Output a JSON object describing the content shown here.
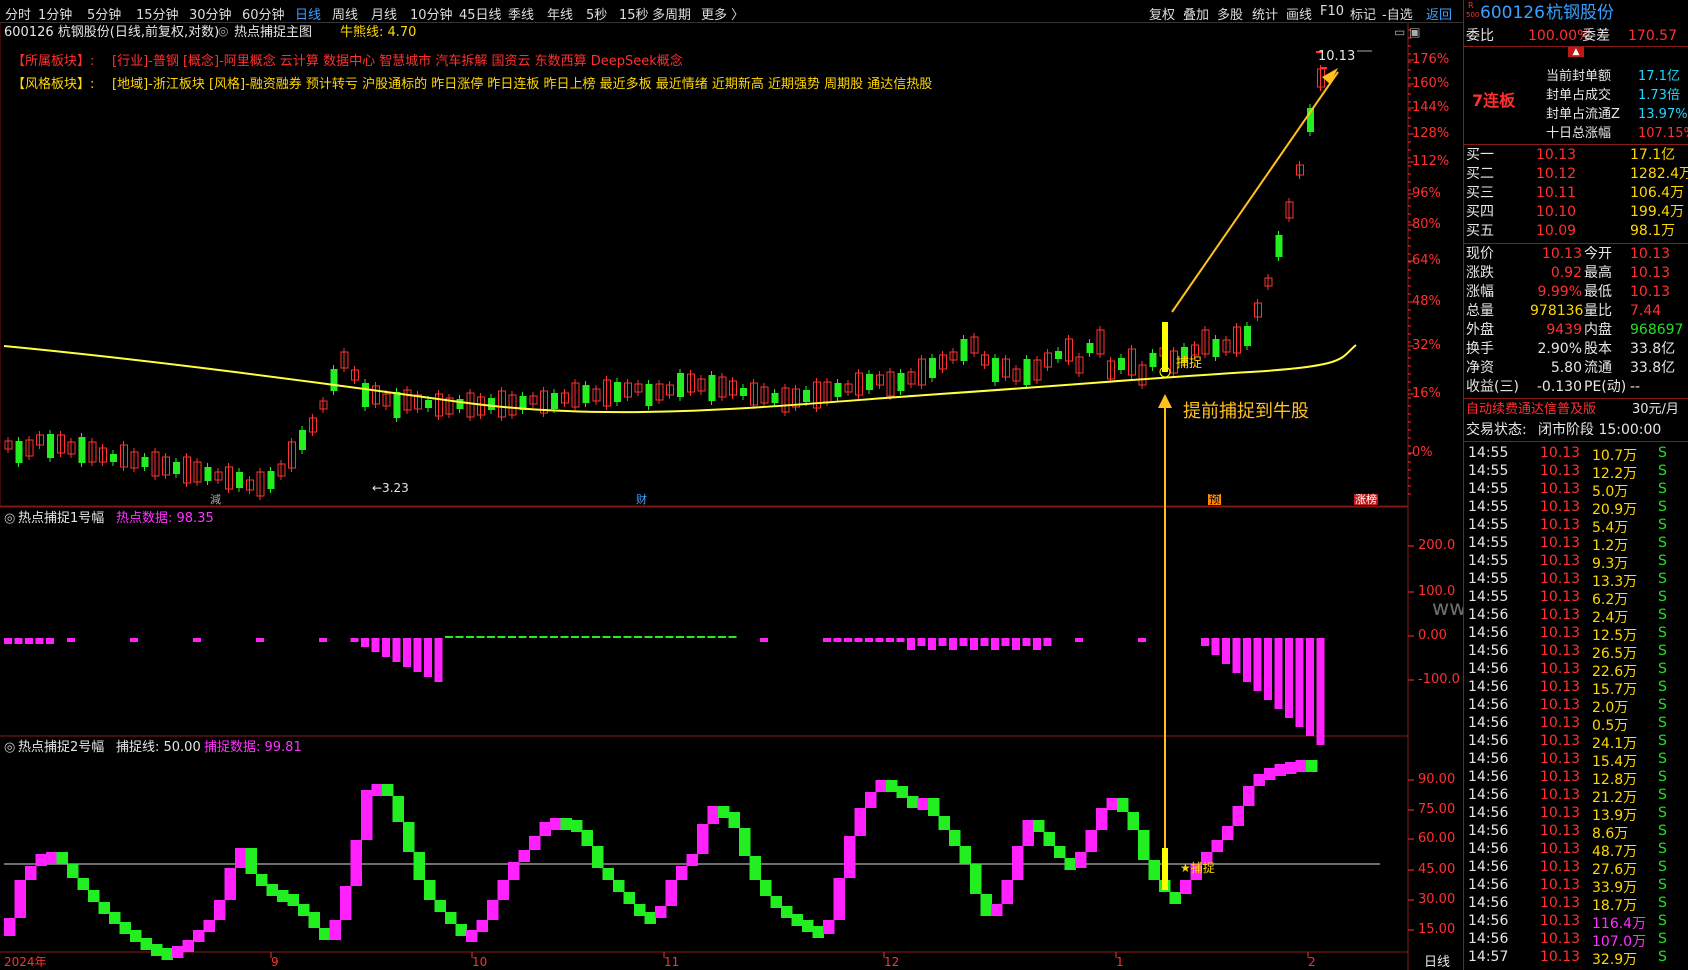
{
  "toolbar": {
    "periods": [
      "分时",
      "1分钟",
      "5分钟",
      "15分钟",
      "30分钟",
      "60分钟",
      "日线",
      "周线",
      "月线",
      "10分钟",
      "45日线",
      "季线",
      "年线",
      "5秒",
      "15秒",
      "多周期",
      "更多 〉"
    ],
    "active_period": "日线",
    "right_buttons": [
      "复权",
      "叠加",
      "多股",
      "统计",
      "画线",
      "F10",
      "标记",
      "-自选",
      "返回"
    ]
  },
  "main_chart": {
    "title": "600126 杭钢股份(日线,前复权,对数)",
    "indicator_name": "热点捕捉主图",
    "indicator_param": "牛熊线: 4.70",
    "sector_label": "【所属板块】:",
    "sector_text": "[行业]-普钢 [概念]-阿里概念 云计算 数据中心 智慧城市 汽车拆解 国资云 东数西算 DeepSeek概念",
    "style_label": "【风格板块】:",
    "style_text": "[地域]-浙江板块 [风格]-融资融券 预计转亏 沪股通标的 昨日涨停 昨日连板 昨日上榜 最近多板 最近情绪 近期新高 近期强势 周期股 通达信热股",
    "high_label": "10.13",
    "low_label": "←3.23",
    "capture_label": "捕捉",
    "annotation": "提前捕捉到牛股",
    "marker_jian": "減",
    "marker_cai": "财",
    "marker_yu": "预",
    "marker_zhangbang": "涨榜",
    "y_axis": [
      "176%",
      "160%",
      "144%",
      "128%",
      "112%",
      "96%",
      "80%",
      "64%",
      "48%",
      "32%",
      "16%",
      "0%"
    ]
  },
  "sub1": {
    "title": "热点捕捉1号幅",
    "data_label": "热点数据: 98.35",
    "y_axis": [
      "200.0",
      "100.0",
      "0.00",
      "-100.0"
    ]
  },
  "sub2": {
    "title": "热点捕捉2号幅",
    "line_label": "捕捉线: 50.00",
    "data_label": "捕捉数据: 99.81",
    "capture_label": "★捕捉",
    "y_axis": [
      "90.00",
      "75.00",
      "60.00",
      "45.00",
      "30.00",
      "15.00"
    ]
  },
  "x_axis": {
    "labels": [
      "2024年",
      "9",
      "10",
      "11",
      "12",
      "1",
      "2"
    ],
    "period_label": "日线"
  },
  "watermark": "www.rfchi.com",
  "right_panel": {
    "code": "600126",
    "name": "杭钢股份",
    "r_badge": "R",
    "r_sub": "500",
    "weibi_label": "委比",
    "weibi_value": "100.00%",
    "weicha_label": "委差",
    "weicha_value": "170.57",
    "board_label": "7连板",
    "seal_rows": [
      {
        "label": "当前封单额",
        "value": "17.1亿"
      },
      {
        "label": "封单占成交",
        "value": "1.73倍"
      },
      {
        "label": "封单占流通Z",
        "value": "13.97%"
      },
      {
        "label": "十日总涨幅",
        "value": "107.15%"
      }
    ],
    "bids": [
      {
        "label": "买一",
        "price": "10.13",
        "vol": "17.1亿"
      },
      {
        "label": "买二",
        "price": "10.12",
        "vol": "1282.4万"
      },
      {
        "label": "买三",
        "price": "10.11",
        "vol": "106.4万"
      },
      {
        "label": "买四",
        "price": "10.10",
        "vol": "199.4万"
      },
      {
        "label": "买五",
        "price": "10.09",
        "vol": "98.1万"
      }
    ],
    "stats": [
      {
        "l1": "现价",
        "v1": "10.13",
        "l2": "今开",
        "v2": "10.13"
      },
      {
        "l1": "涨跌",
        "v1": "0.92",
        "l2": "最高",
        "v2": "10.13"
      },
      {
        "l1": "涨幅",
        "v1": "9.99%",
        "l2": "最低",
        "v2": "10.13"
      },
      {
        "l1": "总量",
        "v1": "978136",
        "l2": "量比",
        "v2": "7.44"
      },
      {
        "l1": "外盘",
        "v1": "9439",
        "l2": "内盘",
        "v2": "968697"
      },
      {
        "l1": "换手",
        "v1": "2.90%",
        "l2": "股本",
        "v2": "33.8亿"
      },
      {
        "l1": "净资",
        "v1": "5.80",
        "l2": "流通",
        "v2": "33.8亿"
      },
      {
        "l1": "收益(三)",
        "v1": "-0.130",
        "l2": "PE(动)",
        "v2": "--"
      }
    ],
    "promo_text": "自动续费通达信普及版",
    "promo_price": "30元/月",
    "status_label": "交易状态:",
    "status_value": "闭市阶段 15:00:00",
    "ticks": [
      {
        "t": "14:55",
        "p": "10.13",
        "v": "10.7万",
        "s": "S"
      },
      {
        "t": "14:55",
        "p": "10.13",
        "v": "12.2万",
        "s": "S"
      },
      {
        "t": "14:55",
        "p": "10.13",
        "v": "5.0万",
        "s": "S"
      },
      {
        "t": "14:55",
        "p": "10.13",
        "v": "20.9万",
        "s": "S"
      },
      {
        "t": "14:55",
        "p": "10.13",
        "v": "5.4万",
        "s": "S"
      },
      {
        "t": "14:55",
        "p": "10.13",
        "v": "1.2万",
        "s": "S"
      },
      {
        "t": "14:55",
        "p": "10.13",
        "v": "9.3万",
        "s": "S"
      },
      {
        "t": "14:55",
        "p": "10.13",
        "v": "13.3万",
        "s": "S"
      },
      {
        "t": "14:55",
        "p": "10.13",
        "v": "6.2万",
        "s": "S"
      },
      {
        "t": "14:56",
        "p": "10.13",
        "v": "2.4万",
        "s": "S"
      },
      {
        "t": "14:56",
        "p": "10.13",
        "v": "12.5万",
        "s": "S"
      },
      {
        "t": "14:56",
        "p": "10.13",
        "v": "26.5万",
        "s": "S"
      },
      {
        "t": "14:56",
        "p": "10.13",
        "v": "22.6万",
        "s": "S"
      },
      {
        "t": "14:56",
        "p": "10.13",
        "v": "15.7万",
        "s": "S"
      },
      {
        "t": "14:56",
        "p": "10.13",
        "v": "2.0万",
        "s": "S"
      },
      {
        "t": "14:56",
        "p": "10.13",
        "v": "0.5万",
        "s": "S"
      },
      {
        "t": "14:56",
        "p": "10.13",
        "v": "24.1万",
        "s": "S"
      },
      {
        "t": "14:56",
        "p": "10.13",
        "v": "15.4万",
        "s": "S"
      },
      {
        "t": "14:56",
        "p": "10.13",
        "v": "12.8万",
        "s": "S"
      },
      {
        "t": "14:56",
        "p": "10.13",
        "v": "21.2万",
        "s": "S"
      },
      {
        "t": "14:56",
        "p": "10.13",
        "v": "13.9万",
        "s": "S"
      },
      {
        "t": "14:56",
        "p": "10.13",
        "v": "8.6万",
        "s": "S"
      },
      {
        "t": "14:56",
        "p": "10.13",
        "v": "48.7万",
        "s": "S"
      },
      {
        "t": "14:56",
        "p": "10.13",
        "v": "27.6万",
        "s": "S"
      },
      {
        "t": "14:56",
        "p": "10.13",
        "v": "33.9万",
        "s": "S"
      },
      {
        "t": "14:56",
        "p": "10.13",
        "v": "18.7万",
        "s": "S"
      },
      {
        "t": "14:56",
        "p": "10.13",
        "v": "116.4万",
        "s": "S"
      },
      {
        "t": "14:56",
        "p": "10.13",
        "v": "107.0万",
        "s": "S"
      },
      {
        "t": "14:57",
        "p": "10.13",
        "v": "32.9万",
        "s": "S"
      }
    ]
  },
  "colors": {
    "up": "#ff3333",
    "down": "#00e0e0",
    "green": "#22ee22",
    "magenta": "#ff22ff",
    "yellow_line": "#ffff40",
    "axis_red": "#ff3030"
  }
}
